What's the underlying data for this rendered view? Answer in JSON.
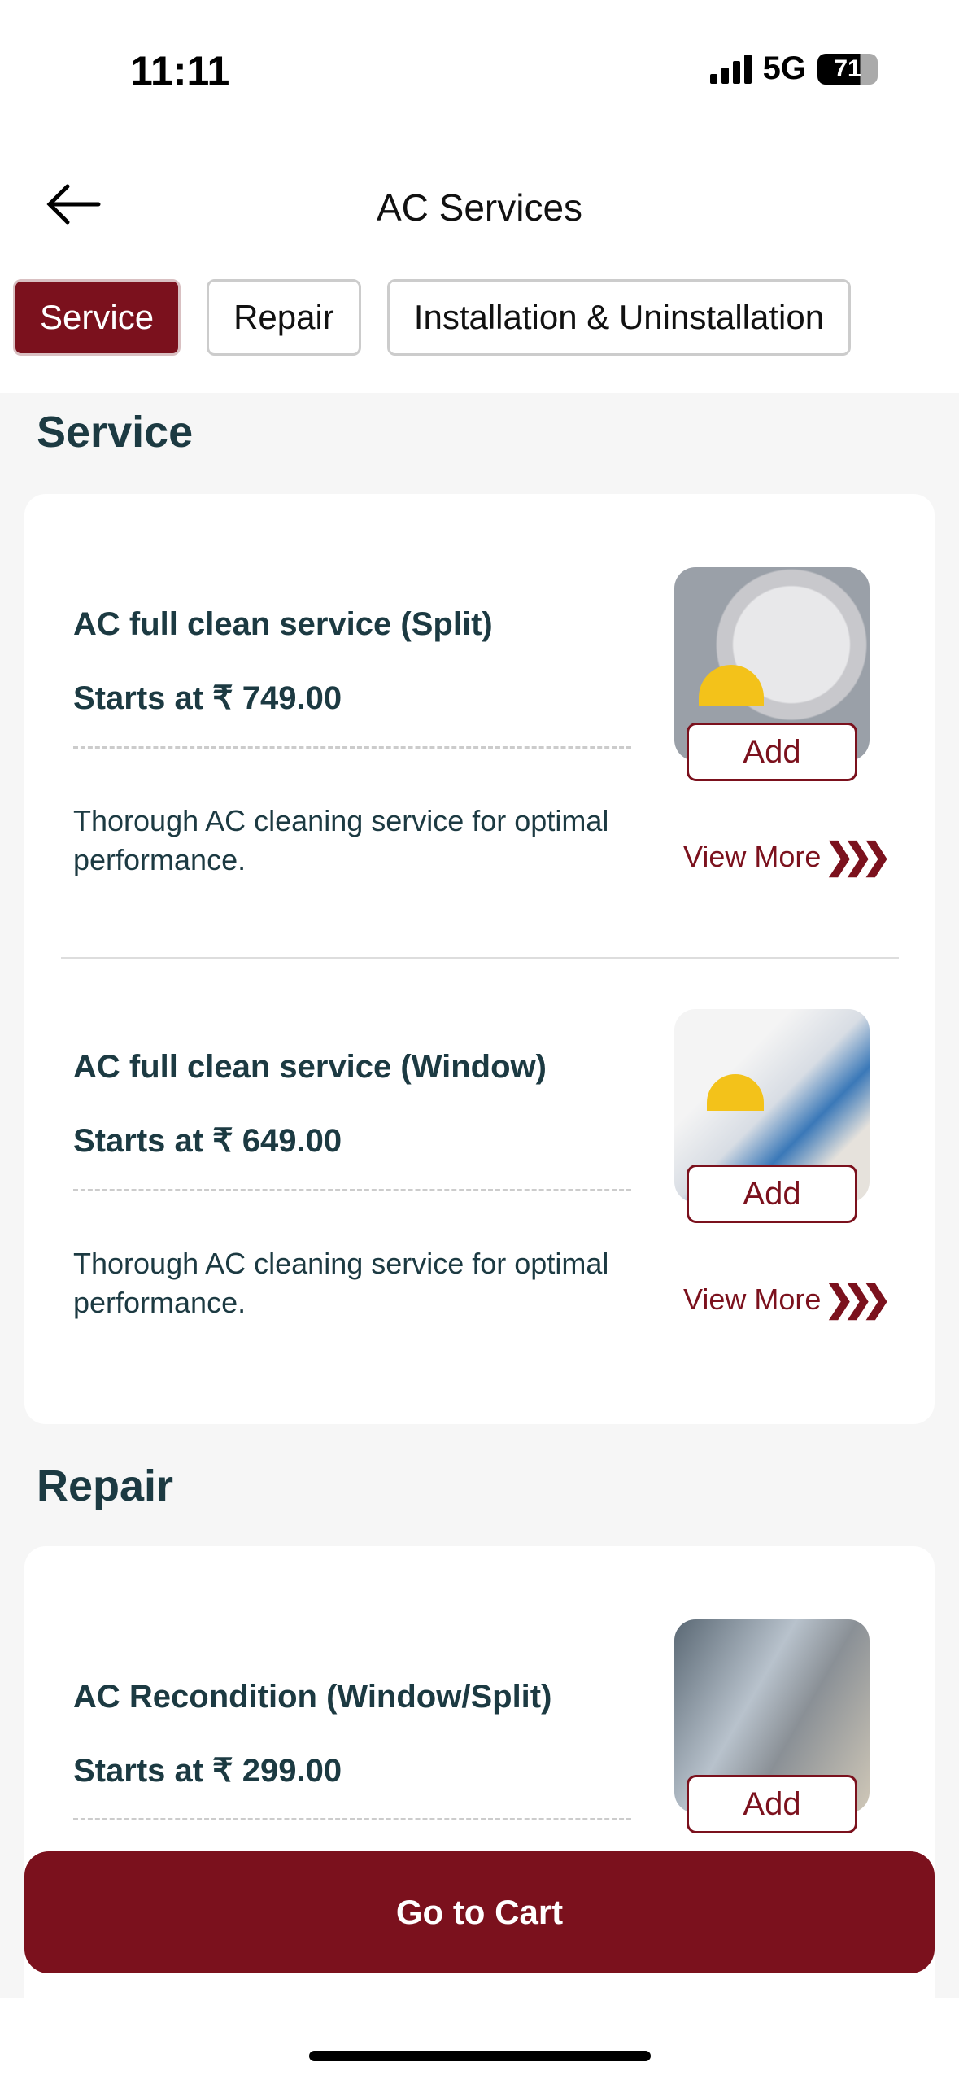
{
  "status": {
    "time": "11:11",
    "network": "5G",
    "battery": "71",
    "battery_level": 71
  },
  "header": {
    "title": "AC Services",
    "back_icon": "arrow-left-icon"
  },
  "tabs": [
    {
      "label": "Service",
      "active": true
    },
    {
      "label": "Repair",
      "active": false
    },
    {
      "label": "Installation & Uninstallation",
      "active": false
    }
  ],
  "sections": [
    {
      "heading": "Service",
      "items": [
        {
          "title": "AC full clean service (Split)",
          "price": "Starts at ₹ 749.00",
          "description": "Thorough AC cleaning service for optimal performance.",
          "add_label": "Add",
          "more_label": "View More"
        },
        {
          "title": "AC full clean service (Window)",
          "price": "Starts at ₹ 649.00",
          "description": "Thorough AC cleaning service for optimal performance.",
          "add_label": "Add",
          "more_label": "View More"
        }
      ]
    },
    {
      "heading": "Repair",
      "items": [
        {
          "title": "AC Recondition (Window/Split)",
          "price": "Starts at ₹ 299.00",
          "add_label": "Add"
        }
      ]
    }
  ],
  "cart_button": "Go to Cart",
  "colors": {
    "accent": "#7b111d",
    "text": "#1c3a42",
    "background": "#f6f6f6"
  }
}
